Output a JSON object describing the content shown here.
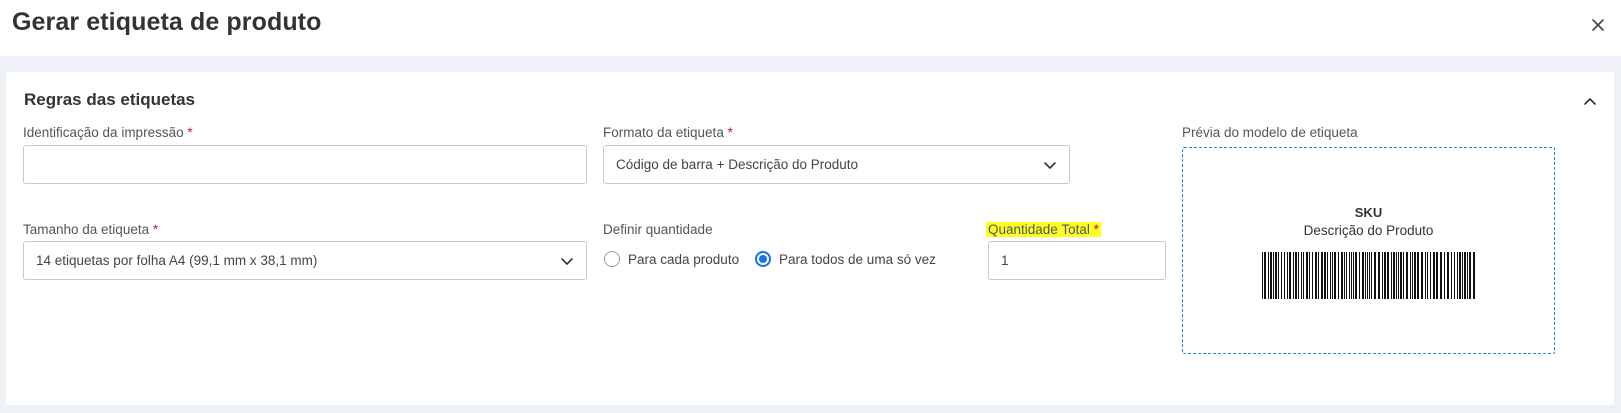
{
  "modal": {
    "title": "Gerar etiqueta de produto",
    "close_icon": "close-icon"
  },
  "section": {
    "title": "Regras das etiquetas",
    "collapse_icon": "chevron-up-icon"
  },
  "fields": {
    "identificacao": {
      "label": "Identificação da impressão",
      "required_mark": "*",
      "value": "",
      "placeholder": ""
    },
    "formato": {
      "label": "Formato da etiqueta",
      "required_mark": "*",
      "value": "Código de barra + Descrição do Produto"
    },
    "tamanho": {
      "label": "Tamanho da etiqueta",
      "required_mark": "*",
      "value": "14 etiquetas por folha A4 (99,1 mm x 38,1 mm)"
    },
    "definir_quantidade": {
      "label": "Definir quantidade",
      "options": [
        {
          "label": "Para cada produto",
          "checked": false
        },
        {
          "label": "Para todos de uma só vez",
          "checked": true
        }
      ]
    },
    "quantidade_total": {
      "label": "Quantidade Total",
      "required_mark": "*",
      "value": "1",
      "highlight_color": "#ffff22"
    }
  },
  "preview": {
    "label": "Prévia do modelo de etiqueta",
    "sku": "SKU",
    "description": "Descrição do Produto",
    "barcode_icon": "barcode-icon"
  },
  "colors": {
    "accent": "#1a73e8",
    "required": "#c21b1b",
    "preview_border": "#2c7fd6",
    "background": "#eef1f5"
  }
}
